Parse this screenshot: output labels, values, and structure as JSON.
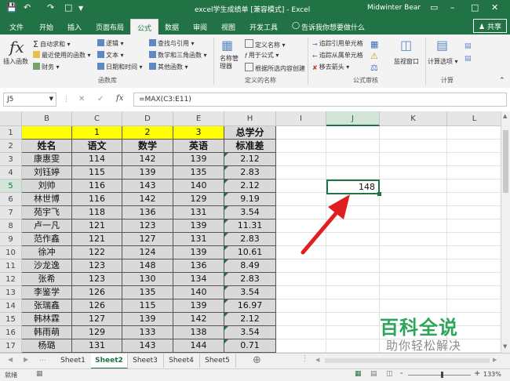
{
  "title_bar": {
    "doc_title": "excel学生成绩单 [兼容模式] - Excel",
    "user": "Midwinter Bear"
  },
  "tabs": [
    "文件",
    "开始",
    "插入",
    "页面布局",
    "公式",
    "数据",
    "审阅",
    "视图",
    "开发工具"
  ],
  "active_tab": "公式",
  "tell_me": "告诉我你想要做什么",
  "share": "共享",
  "ribbon": {
    "insert_function": "插入函数",
    "autosum": "自动求和",
    "recent": "最近使用的函数",
    "financial": "财务",
    "logical": "逻辑",
    "text": "文本",
    "datetime": "日期和时间",
    "lookup": "查找与引用",
    "math": "数学和三角函数",
    "other": "其他函数",
    "group_library": "函数库",
    "name_manager": "名称管理器",
    "define_name": "定义名称",
    "use_in_formula": "用于公式",
    "create_from_selection": "根据所选内容创建",
    "group_names": "定义的名称",
    "trace_precedents": "追踪引用单元格",
    "trace_dependents": "追踪从属单元格",
    "remove_arrows": "移去箭头",
    "group_auditing": "公式审核",
    "watch_window": "监视窗口",
    "calc_options": "计算选项",
    "group_calc": "计算"
  },
  "formula_bar": {
    "name_box": "J5",
    "formula": "=MAX(C3:E11)"
  },
  "columns": [
    "B",
    "C",
    "D",
    "E",
    "H",
    "I",
    "J",
    "K",
    "L"
  ],
  "rows": [
    "1",
    "2",
    "3",
    "4",
    "5",
    "6",
    "7",
    "8",
    "9",
    "10",
    "11",
    "12",
    "13",
    "14",
    "15",
    "16",
    "17"
  ],
  "row1": {
    "c": "1",
    "d": "2",
    "e": "3",
    "h": "总学分"
  },
  "headers": {
    "b": "姓名",
    "c": "语文",
    "d": "数学",
    "e": "英语",
    "h": "标准差"
  },
  "table": [
    {
      "name": "康惠雯",
      "c": "114",
      "d": "142",
      "e": "139",
      "h": "2.12"
    },
    {
      "name": "刘钰婷",
      "c": "115",
      "d": "139",
      "e": "135",
      "h": "2.83"
    },
    {
      "name": "刘帅",
      "c": "116",
      "d": "143",
      "e": "140",
      "h": "2.12"
    },
    {
      "name": "林世博",
      "c": "116",
      "d": "142",
      "e": "129",
      "h": "9.19"
    },
    {
      "name": "苑宇飞",
      "c": "118",
      "d": "136",
      "e": "131",
      "h": "3.54"
    },
    {
      "name": "卢一凡",
      "c": "121",
      "d": "123",
      "e": "139",
      "h": "11.31"
    },
    {
      "name": "范作鑫",
      "c": "121",
      "d": "127",
      "e": "131",
      "h": "2.83"
    },
    {
      "name": "徐冲",
      "c": "122",
      "d": "124",
      "e": "139",
      "h": "10.61"
    },
    {
      "name": "沙龙逸",
      "c": "123",
      "d": "148",
      "e": "136",
      "h": "8.49"
    },
    {
      "name": "张希",
      "c": "123",
      "d": "130",
      "e": "134",
      "h": "2.83"
    },
    {
      "name": "李鉴学",
      "c": "126",
      "d": "135",
      "e": "140",
      "h": "3.54"
    },
    {
      "name": "张瑞鑫",
      "c": "126",
      "d": "115",
      "e": "139",
      "h": "16.97"
    },
    {
      "name": "韩林霖",
      "c": "127",
      "d": "139",
      "e": "142",
      "h": "2.12"
    },
    {
      "name": "韩雨萌",
      "c": "129",
      "d": "133",
      "e": "138",
      "h": "3.54"
    },
    {
      "name": "杨璐",
      "c": "131",
      "d": "143",
      "e": "144",
      "h": "0.71"
    }
  ],
  "active_cell_value": "148",
  "sheets": [
    "Sheet1",
    "Sheet2",
    "Sheet3",
    "Sheet4",
    "Sheet5"
  ],
  "active_sheet": "Sheet2",
  "status": {
    "ready": "就绪",
    "zoom": "133%"
  },
  "watermark": {
    "main": "百科全说",
    "sub": "助你轻松解决"
  },
  "colors": {
    "excel_green": "#217346",
    "arrow_red": "#e02020",
    "highlight_yellow": "#ffff00",
    "watermark_green": "#2aa55a"
  }
}
